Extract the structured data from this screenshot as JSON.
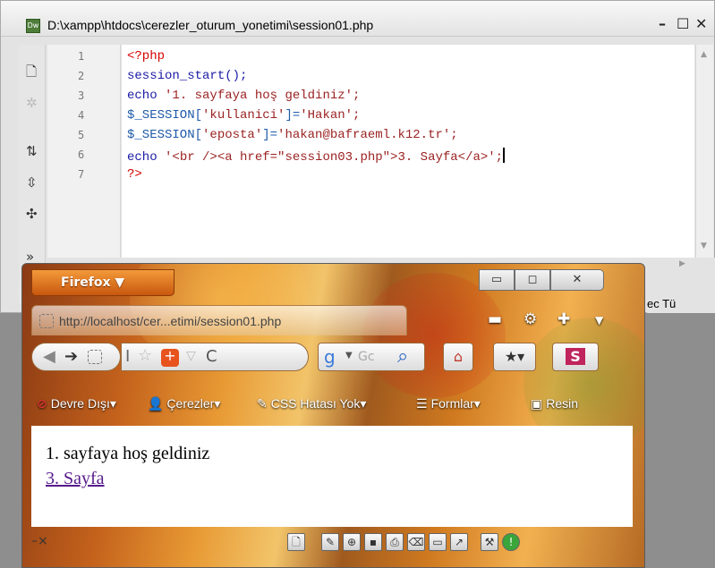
{
  "editor": {
    "title": "D:\\xampp\\htdocs\\cerezler_oturum_yonetimi\\session01.php",
    "app_icon_label": "Dw",
    "minimize": "–",
    "maximize": "☐",
    "close": "✕",
    "line_numbers": [
      "1",
      "2",
      "3",
      "4",
      "5",
      "6",
      "7"
    ],
    "code": {
      "l1": "<?php",
      "l2": "session_start();",
      "l3_kw": "echo ",
      "l3_str": "'1. sayfaya hoş geldiniz';",
      "l4_var": "$_SESSION[",
      "l4_key": "'kullanici'",
      "l4_mid": "]=",
      "l4_val": "'Hakan';",
      "l5_var": "$_SESSION[",
      "l5_key": "'eposta'",
      "l5_mid": "]=",
      "l5_val": "'hakan@bafraeml.k12.tr';",
      "l6_kw": "echo ",
      "l6_str": "'<br /><a href=\"session03.php\">3. Sayfa</a>';",
      "l7": "?>"
    },
    "status": "ec  Tü"
  },
  "firefox": {
    "menu_label": "Firefox ▼",
    "tab_title": "http://localhost/cer...etimi/session01.php",
    "window_controls": {
      "minimize": "▭",
      "restore": "◻",
      "close": "✕"
    },
    "bookmarks": [
      {
        "icon": "⊘",
        "label": "Devre Dışı▾"
      },
      {
        "icon": "👤",
        "label": "Çerezler▾"
      },
      {
        "icon": "✎",
        "label": "CSS Hatası Yok▾"
      },
      {
        "icon": "☰",
        "label": "Formlar▾"
      },
      {
        "icon": "▣",
        "label": "Resin"
      }
    ],
    "search_engine_hint": "Gc",
    "page": {
      "line1": "1. sayfaya hoş geldiniz",
      "link": "3. Sayfa"
    },
    "addon_close": "–×"
  }
}
